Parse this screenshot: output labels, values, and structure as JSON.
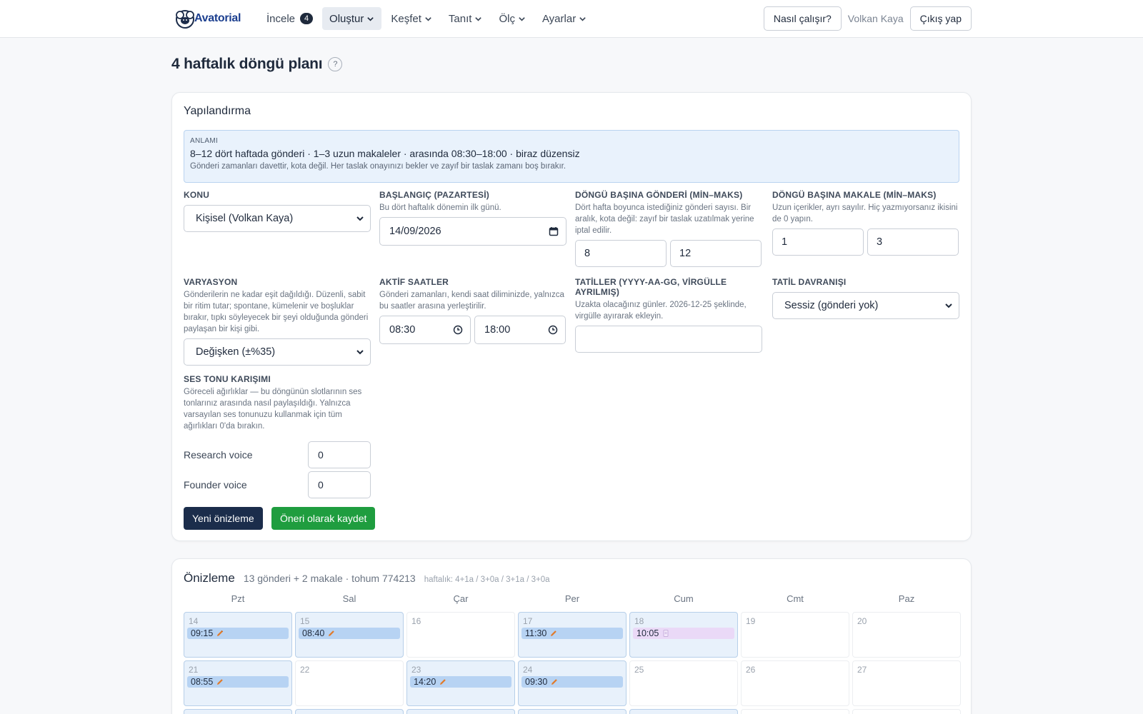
{
  "nav": {
    "brand": "Avatorial",
    "items": [
      {
        "label": "İncele",
        "count": "4"
      },
      {
        "label": "Oluştur"
      },
      {
        "label": "Keşfet"
      },
      {
        "label": "Tanıt"
      },
      {
        "label": "Ölç"
      },
      {
        "label": "Ayarlar"
      }
    ],
    "how_it_works": "Nasıl çalışır?",
    "user": "Volkan Kaya",
    "logout": "Çıkış yap"
  },
  "page": {
    "title": "4 haftalık döngü planı",
    "help": "?"
  },
  "config": {
    "title": "Yapılandırma",
    "summary": {
      "label": "ANLAMI",
      "line": "8–12 dört haftada gönderi · 1–3 uzun makaleler · arasında 08:30–18:00 · biraz düzensiz",
      "note": "Gönderi zamanları davettir, kota değil. Her taslak onayınızı bekler ve zayıf bir taslak zamanı boş bırakır."
    },
    "topic": {
      "label": "KONU",
      "value": "Kişisel (Volkan Kaya)"
    },
    "start": {
      "label": "BAŞLANGIÇ (PAZARTESİ)",
      "help": "Bu dört haftalık dönemin ilk günü.",
      "value": "14/09/2026"
    },
    "posts": {
      "label": "DÖNGÜ BAŞINA GÖNDERİ (MİN–MAKS)",
      "help": "Dört hafta boyunca istediğiniz gönderi sayısı. Bir aralık, kota değil: zayıf bir taslak uzatılmak yerine iptal edilir.",
      "min": "8",
      "max": "12"
    },
    "articles": {
      "label": "DÖNGÜ BAŞINA MAKALE (MİN–MAKS)",
      "help": "Uzun içerikler, ayrı sayılır. Hiç yazmıyorsanız ikisini de 0 yapın.",
      "min": "1",
      "max": "3"
    },
    "variation": {
      "label": "VARYASYON",
      "help": "Gönderilerin ne kadar eşit dağıldığı. Düzenli, sabit bir ritim tutar; spontane, kümelenir ve boşluklar bırakır, tıpkı söyleyecek bir şeyi olduğunda gönderi paylaşan bir kişi gibi.",
      "value": "Değişken (±%35)"
    },
    "hours": {
      "label": "AKTİF SAATLER",
      "help": "Gönderi zamanları, kendi saat diliminizde, yalnızca bu saatler arasına yerleştirilir.",
      "from": "08:30",
      "to": "18:00"
    },
    "holidays": {
      "label": "TATİLLER (YYYY-AA-GG, VİRGÜLLE AYRILMIŞ)",
      "help": "Uzakta olacağınız günler. 2026-12-25 şeklinde, virgülle ayırarak ekleyin.",
      "value": ""
    },
    "holiday_behavior": {
      "label": "TATİL DAVRANIŞI",
      "value": "Sessiz (gönderi yok)"
    },
    "tone": {
      "label": "SES TONU KARIŞIMI",
      "help": "Göreceli ağırlıklar — bu döngünün slotlarının ses tonlarınız arasında nasıl paylaşıldığı. Yalnızca varsayılan ses tonunuzu kullanmak için tüm ağırlıkları 0'da bırakın.",
      "voices": [
        {
          "name": "Research voice",
          "weight": "0"
        },
        {
          "name": "Founder voice",
          "weight": "0"
        }
      ]
    },
    "btn_preview": "Yeni önizleme",
    "btn_save": "Öneri olarak kaydet"
  },
  "preview": {
    "title": "Önizleme",
    "meta": "13 gönderi + 2 makale · tohum 774213",
    "weekly": "haftalık: 4+1a / 3+0a / 3+1a / 3+0a",
    "weekdays": [
      "Pzt",
      "Sal",
      "Çar",
      "Per",
      "Cum",
      "Cmt",
      "Paz"
    ],
    "rows": [
      [
        {
          "day": "14",
          "time": "09:15",
          "kind": "post"
        },
        {
          "day": "15",
          "time": "08:40",
          "kind": "post"
        },
        {
          "day": "16"
        },
        {
          "day": "17",
          "time": "11:30",
          "kind": "post"
        },
        {
          "day": "18",
          "time": "10:05",
          "kind": "article"
        },
        {
          "day": "19"
        },
        {
          "day": "20"
        }
      ],
      [
        {
          "day": "21",
          "time": "08:55",
          "kind": "post"
        },
        {
          "day": "22"
        },
        {
          "day": "23",
          "time": "14:20",
          "kind": "post"
        },
        {
          "day": "24",
          "time": "09:30",
          "kind": "post"
        },
        {
          "day": "25"
        },
        {
          "day": "26"
        },
        {
          "day": "27"
        }
      ]
    ]
  },
  "colors": {
    "slot_post": "#b7d3f3",
    "slot_article": "#ead9f7",
    "btn_dark": "#1b2d4b",
    "btn_green": "#1f9d3f",
    "summary_bg": "#e9f2fc"
  }
}
